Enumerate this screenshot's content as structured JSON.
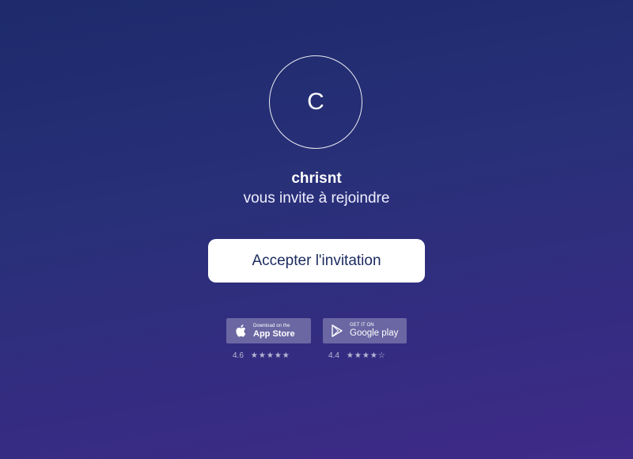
{
  "avatar": {
    "initial": "C"
  },
  "inviter": {
    "name": "chrisnt",
    "message": "vous invite à rejoindre"
  },
  "actions": {
    "accept_label": "Accepter l'invitation"
  },
  "stores": [
    {
      "icon": "apple-icon",
      "small_text": "Download on the",
      "large_text": "App Store",
      "rating": "4.6",
      "stars_filled": 5
    },
    {
      "icon": "google-play-icon",
      "small_text": "GET IT ON",
      "large_text": "Google play",
      "rating": "4.4",
      "stars_filled": 4.5
    }
  ],
  "colors": {
    "background_top": "#1d2a6b",
    "background_bottom": "#3f2a88",
    "button_bg": "#ffffff",
    "button_text": "#1b2a5e"
  }
}
